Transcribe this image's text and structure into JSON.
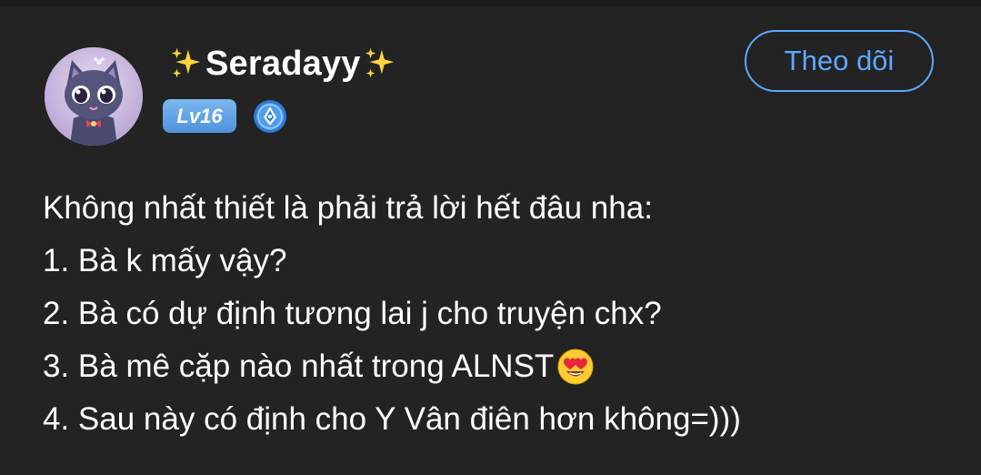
{
  "profile": {
    "username": "Seradayy",
    "level": "Lv16"
  },
  "actions": {
    "follow_label": "Theo dõi"
  },
  "post": {
    "lines": [
      "Không nhất thiết là phải trả lời hết đâu nha:",
      "1. Bà k mấy vậy?",
      "2. Bà có dự định tương lai j cho truyện chx?",
      "3. Bà mê cặp nào nhất trong ALNST",
      "4. Sau này có định cho Y Vân điên hơn không=)))"
    ],
    "emoji_after_line_4": "heart-eyes-emoji"
  },
  "colors": {
    "background": "#232323",
    "accent": "#5ea8ff",
    "level_badge": "#5a9be0",
    "sparkle": "#ffd43b"
  }
}
